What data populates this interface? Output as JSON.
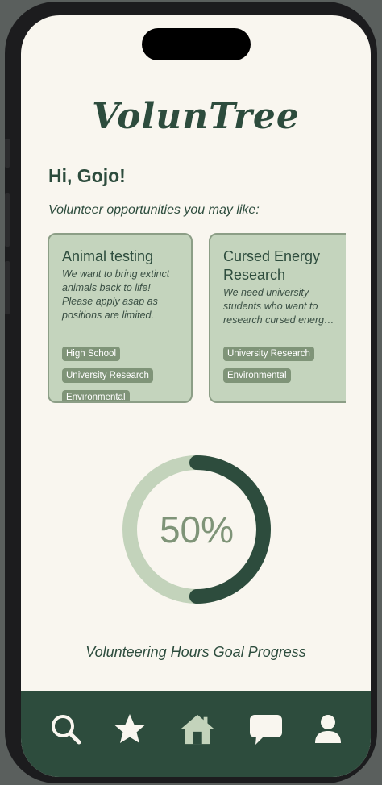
{
  "app": {
    "logo": "VolunTree"
  },
  "greeting": "Hi, Gojo!",
  "subtitle": "Volunteer opportunities you may like:",
  "opportunities": [
    {
      "title": "Animal testing",
      "description": "We want to bring extinct animals back to life! Please apply asap as positions are limited.",
      "tags": [
        "High School",
        "University Research",
        "Environmental"
      ]
    },
    {
      "title": "Cursed Energy Research",
      "description": "We need university students who want to research cursed energ…",
      "tags": [
        "University Research",
        "Environmental"
      ]
    }
  ],
  "progress": {
    "percent": 50,
    "display": "50%",
    "label": "Volunteering Hours Goal Progress"
  },
  "nav": [
    {
      "icon": "search-icon"
    },
    {
      "icon": "star-icon"
    },
    {
      "icon": "home-icon"
    },
    {
      "icon": "chat-icon"
    },
    {
      "icon": "profile-icon"
    }
  ],
  "colors": {
    "primary": "#2d4c3d",
    "card": "#c4d4bd",
    "tag": "#7f9478",
    "ring_track": "#c3d3bb",
    "background": "#f9f6ef"
  }
}
